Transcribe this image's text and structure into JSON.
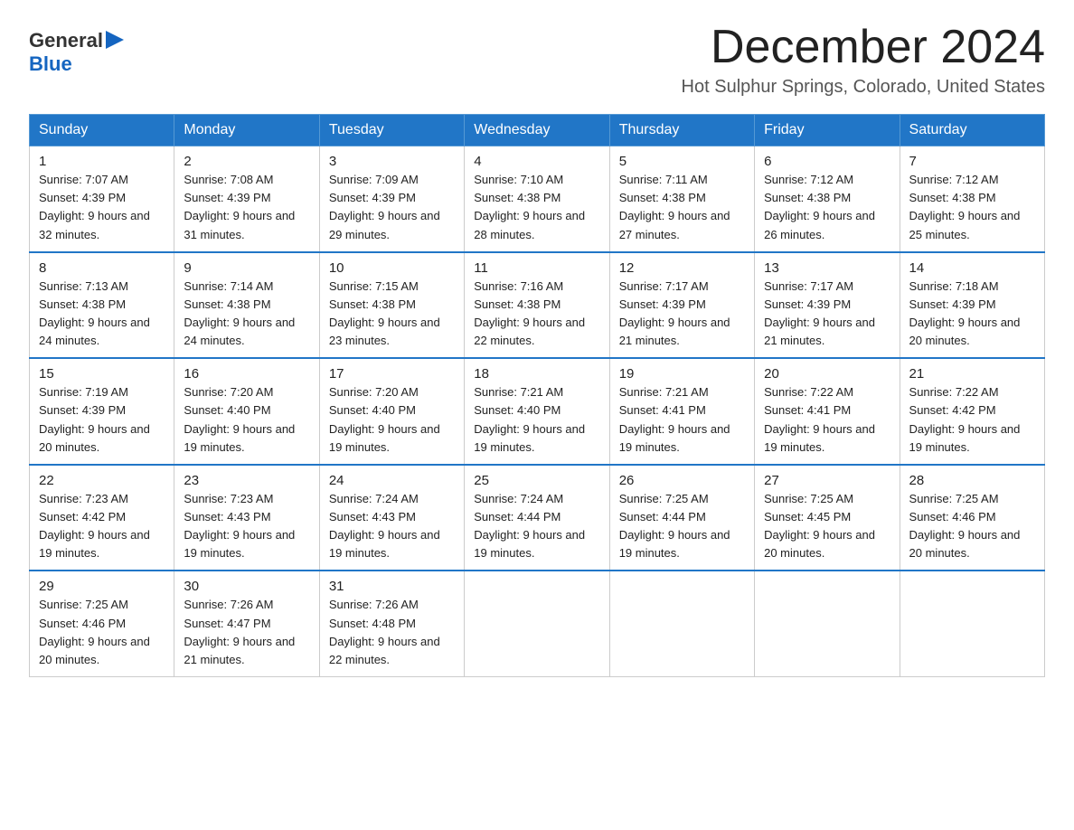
{
  "logo": {
    "text_general": "General",
    "text_blue": "Blue"
  },
  "title": {
    "month": "December 2024",
    "location": "Hot Sulphur Springs, Colorado, United States"
  },
  "weekdays": [
    "Sunday",
    "Monday",
    "Tuesday",
    "Wednesday",
    "Thursday",
    "Friday",
    "Saturday"
  ],
  "weeks": [
    [
      {
        "day": "1",
        "sunrise": "7:07 AM",
        "sunset": "4:39 PM",
        "daylight": "9 hours and 32 minutes."
      },
      {
        "day": "2",
        "sunrise": "7:08 AM",
        "sunset": "4:39 PM",
        "daylight": "9 hours and 31 minutes."
      },
      {
        "day": "3",
        "sunrise": "7:09 AM",
        "sunset": "4:39 PM",
        "daylight": "9 hours and 29 minutes."
      },
      {
        "day": "4",
        "sunrise": "7:10 AM",
        "sunset": "4:38 PM",
        "daylight": "9 hours and 28 minutes."
      },
      {
        "day": "5",
        "sunrise": "7:11 AM",
        "sunset": "4:38 PM",
        "daylight": "9 hours and 27 minutes."
      },
      {
        "day": "6",
        "sunrise": "7:12 AM",
        "sunset": "4:38 PM",
        "daylight": "9 hours and 26 minutes."
      },
      {
        "day": "7",
        "sunrise": "7:12 AM",
        "sunset": "4:38 PM",
        "daylight": "9 hours and 25 minutes."
      }
    ],
    [
      {
        "day": "8",
        "sunrise": "7:13 AM",
        "sunset": "4:38 PM",
        "daylight": "9 hours and 24 minutes."
      },
      {
        "day": "9",
        "sunrise": "7:14 AM",
        "sunset": "4:38 PM",
        "daylight": "9 hours and 24 minutes."
      },
      {
        "day": "10",
        "sunrise": "7:15 AM",
        "sunset": "4:38 PM",
        "daylight": "9 hours and 23 minutes."
      },
      {
        "day": "11",
        "sunrise": "7:16 AM",
        "sunset": "4:38 PM",
        "daylight": "9 hours and 22 minutes."
      },
      {
        "day": "12",
        "sunrise": "7:17 AM",
        "sunset": "4:39 PM",
        "daylight": "9 hours and 21 minutes."
      },
      {
        "day": "13",
        "sunrise": "7:17 AM",
        "sunset": "4:39 PM",
        "daylight": "9 hours and 21 minutes."
      },
      {
        "day": "14",
        "sunrise": "7:18 AM",
        "sunset": "4:39 PM",
        "daylight": "9 hours and 20 minutes."
      }
    ],
    [
      {
        "day": "15",
        "sunrise": "7:19 AM",
        "sunset": "4:39 PM",
        "daylight": "9 hours and 20 minutes."
      },
      {
        "day": "16",
        "sunrise": "7:20 AM",
        "sunset": "4:40 PM",
        "daylight": "9 hours and 19 minutes."
      },
      {
        "day": "17",
        "sunrise": "7:20 AM",
        "sunset": "4:40 PM",
        "daylight": "9 hours and 19 minutes."
      },
      {
        "day": "18",
        "sunrise": "7:21 AM",
        "sunset": "4:40 PM",
        "daylight": "9 hours and 19 minutes."
      },
      {
        "day": "19",
        "sunrise": "7:21 AM",
        "sunset": "4:41 PM",
        "daylight": "9 hours and 19 minutes."
      },
      {
        "day": "20",
        "sunrise": "7:22 AM",
        "sunset": "4:41 PM",
        "daylight": "9 hours and 19 minutes."
      },
      {
        "day": "21",
        "sunrise": "7:22 AM",
        "sunset": "4:42 PM",
        "daylight": "9 hours and 19 minutes."
      }
    ],
    [
      {
        "day": "22",
        "sunrise": "7:23 AM",
        "sunset": "4:42 PM",
        "daylight": "9 hours and 19 minutes."
      },
      {
        "day": "23",
        "sunrise": "7:23 AM",
        "sunset": "4:43 PM",
        "daylight": "9 hours and 19 minutes."
      },
      {
        "day": "24",
        "sunrise": "7:24 AM",
        "sunset": "4:43 PM",
        "daylight": "9 hours and 19 minutes."
      },
      {
        "day": "25",
        "sunrise": "7:24 AM",
        "sunset": "4:44 PM",
        "daylight": "9 hours and 19 minutes."
      },
      {
        "day": "26",
        "sunrise": "7:25 AM",
        "sunset": "4:44 PM",
        "daylight": "9 hours and 19 minutes."
      },
      {
        "day": "27",
        "sunrise": "7:25 AM",
        "sunset": "4:45 PM",
        "daylight": "9 hours and 20 minutes."
      },
      {
        "day": "28",
        "sunrise": "7:25 AM",
        "sunset": "4:46 PM",
        "daylight": "9 hours and 20 minutes."
      }
    ],
    [
      {
        "day": "29",
        "sunrise": "7:25 AM",
        "sunset": "4:46 PM",
        "daylight": "9 hours and 20 minutes."
      },
      {
        "day": "30",
        "sunrise": "7:26 AM",
        "sunset": "4:47 PM",
        "daylight": "9 hours and 21 minutes."
      },
      {
        "day": "31",
        "sunrise": "7:26 AM",
        "sunset": "4:48 PM",
        "daylight": "9 hours and 22 minutes."
      },
      null,
      null,
      null,
      null
    ]
  ]
}
